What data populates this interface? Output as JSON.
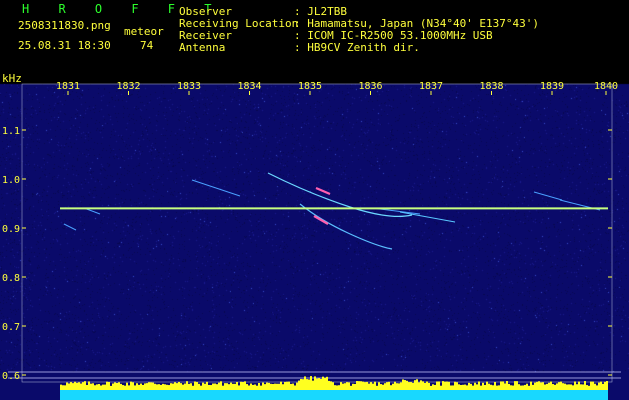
{
  "header": {
    "app_title": "H R O F F T",
    "filename": "2508311830.png",
    "datetime": "25.08.31 18:30",
    "count_label": "meteor",
    "count_value": "74",
    "info": [
      {
        "label": "Observer",
        "value": ": JL2TBB"
      },
      {
        "label": "Receiving Location",
        "value": ": Hamamatsu, Japan (N34°40' E137°43')"
      },
      {
        "label": "Receiver",
        "value": ": ICOM IC-R2500 53.1000MHz USB"
      },
      {
        "label": "Antenna",
        "value": ": HB9CV Zenith dir."
      }
    ]
  },
  "chart_data": {
    "type": "heatmap",
    "ylabel": "kHz",
    "ylim": [
      0.6,
      1.16
    ],
    "y_ticks": [
      "1.1",
      "1.0",
      "0.9",
      "0.8",
      "0.7",
      "0.6"
    ],
    "x_tick_labels": [
      "1831",
      "1832",
      "1833",
      "1834",
      "1835",
      "1836",
      "1837",
      "1838",
      "1839",
      "1840"
    ],
    "carrier_khz": 0.94,
    "colors": {
      "background": "#0a0a6a",
      "carrier": "#c8ff80",
      "tick": "#ffff3c",
      "level": "#18d8ff"
    }
  }
}
